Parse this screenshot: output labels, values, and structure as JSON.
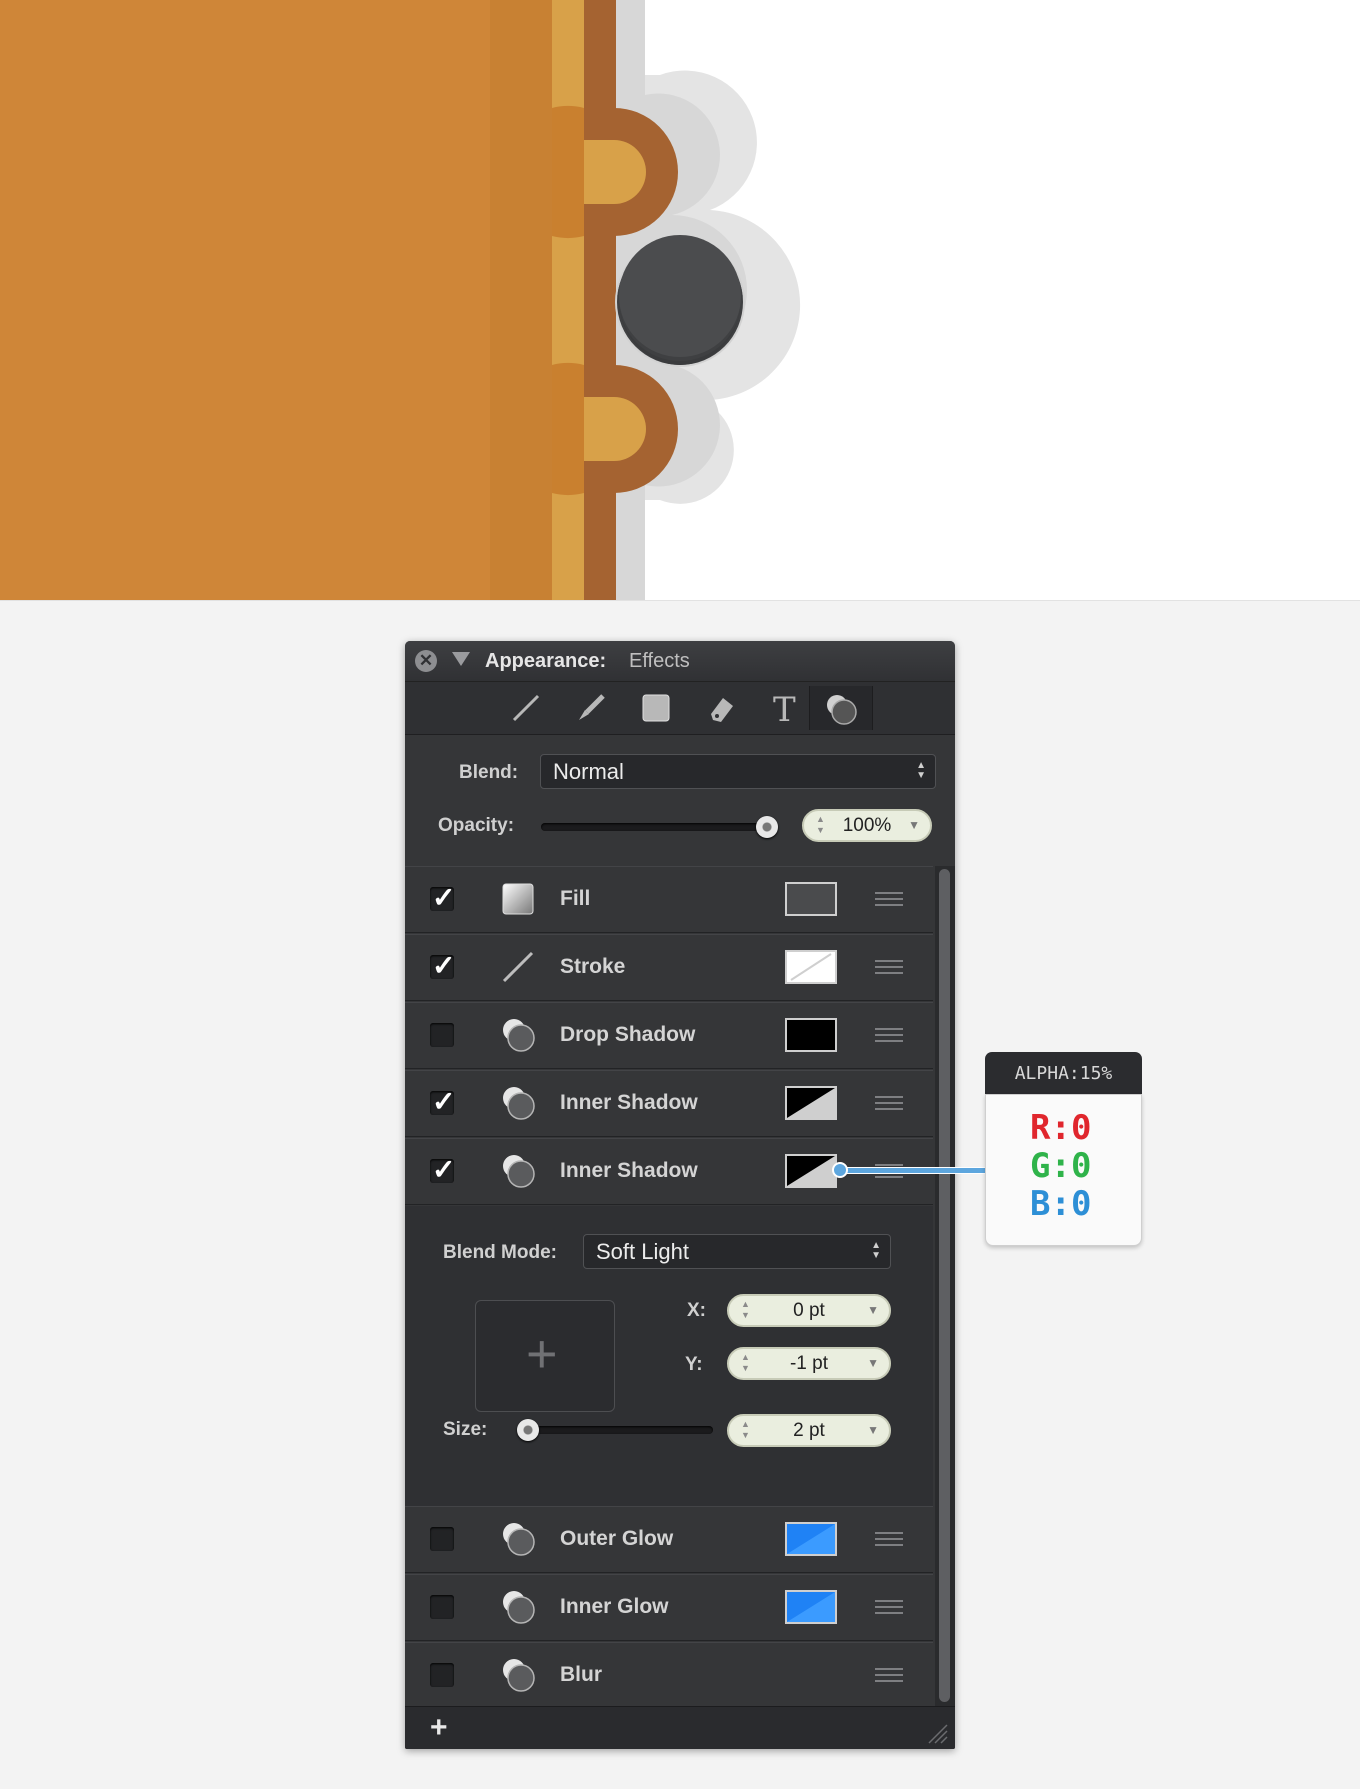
{
  "panel": {
    "title": "Appearance:",
    "subtitle": "Effects",
    "toolbar_icons": [
      "line-tool-icon",
      "brush-tool-icon",
      "square-tool-icon",
      "eraser-tool-icon",
      "text-tool-icon",
      "effects-tool-icon"
    ],
    "blend": {
      "label": "Blend:",
      "value": "Normal"
    },
    "opacity": {
      "label": "Opacity:",
      "value": "100%",
      "level": 1.0
    },
    "effects": [
      {
        "label": "Fill",
        "checked": true,
        "icon": "fill-icon",
        "swatch": "#4a4b4d"
      },
      {
        "label": "Stroke",
        "checked": true,
        "icon": "stroke-icon",
        "swatch": "#ffffff"
      },
      {
        "label": "Drop Shadow",
        "checked": false,
        "icon": "effect-icon",
        "swatch": "#000000"
      },
      {
        "label": "Inner Shadow",
        "checked": true,
        "icon": "effect-icon",
        "swatch": "#000000"
      },
      {
        "label": "Inner Shadow",
        "checked": true,
        "icon": "effect-icon",
        "swatch": "#000000"
      },
      {
        "label": "Outer Glow",
        "checked": false,
        "icon": "effect-icon",
        "swatch": "#1f82f5"
      },
      {
        "label": "Inner Glow",
        "checked": false,
        "icon": "effect-icon",
        "swatch": "#1f82f5"
      },
      {
        "label": "Blur",
        "checked": false,
        "icon": "effect-icon"
      }
    ],
    "detail": {
      "blend_mode_label": "Blend Mode:",
      "blend_mode_value": "Soft Light",
      "x_label": "X:",
      "x_value": "0 pt",
      "y_label": "Y:",
      "y_value": "-1 pt",
      "size_label": "Size:",
      "size_value": "2 pt",
      "size_level": 0.0
    },
    "add_label": "+"
  },
  "tooltip": {
    "alpha": "ALPHA:15%",
    "r": "R:0",
    "g": "G:0",
    "b": "B:0"
  },
  "colors": {
    "orange": "#cf8638",
    "light_orange": "#d8a149",
    "brown": "#a56331",
    "knob": "#4a4b4d",
    "shadow": "#e0e0e0",
    "r": "#e0262d",
    "g": "#2fb34a",
    "b": "#2d8fd6"
  }
}
